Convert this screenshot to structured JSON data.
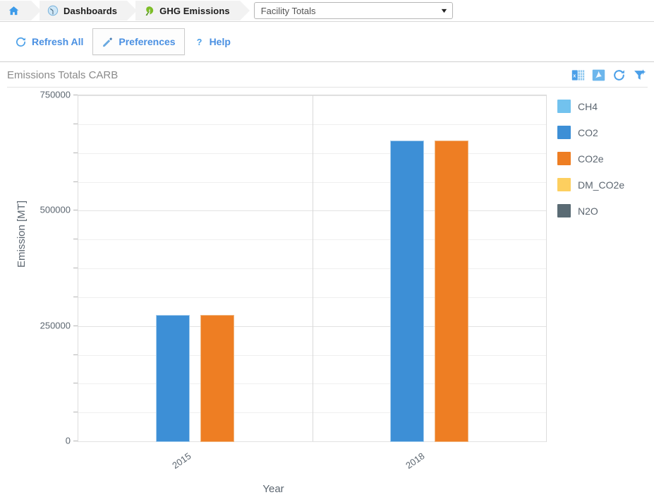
{
  "breadcrumb": {
    "home_icon": "home-icon",
    "items": [
      {
        "icon": "dashboard-gauge-icon",
        "label": "Dashboards"
      },
      {
        "icon": "green-leaf-icon",
        "label": "GHG Emissions"
      }
    ]
  },
  "facility_select": {
    "value": "Facility Totals",
    "caret": "▼",
    "options": [
      "Facility Totals"
    ]
  },
  "toolbar": {
    "refresh_label": "Refresh All",
    "preferences_label": "Preferences",
    "help_label": "Help",
    "help_icon": "question-mark-icon",
    "refresh_icon": "refresh-icon",
    "preferences_icon": "pencil-icon"
  },
  "panel": {
    "title": "Emissions Totals CARB",
    "tools": [
      {
        "name": "export-excel-icon",
        "title": "Excel"
      },
      {
        "name": "export-pdf-icon",
        "title": "PDF"
      },
      {
        "name": "refresh-icon",
        "title": "Refresh"
      },
      {
        "name": "filter-settings-icon",
        "title": "Filter"
      }
    ]
  },
  "colors": {
    "ch4": "#72c2ee",
    "co2": "#3d8fd6",
    "co2e": "#ee7e23",
    "dm_co2e": "#fdcf5f",
    "n2o": "#5a6b74",
    "accent": "#4a90e2",
    "axis_text": "#5c6670"
  },
  "chart_data": {
    "type": "bar",
    "title": "Emissions Totals CARB",
    "xlabel": "Year",
    "ylabel": "Emission [MT]",
    "categories": [
      "2015",
      "2018"
    ],
    "ylim": [
      0,
      750000
    ],
    "ytick_labels": [
      "0",
      "250000",
      "500000",
      "750000"
    ],
    "ytick_values": [
      0,
      250000,
      500000,
      750000
    ],
    "minor_tick_step": 62500,
    "grid": true,
    "legend_position": "right",
    "series": [
      {
        "name": "CH4",
        "color": "#72c2ee",
        "values": [
          0,
          0
        ]
      },
      {
        "name": "CO2",
        "color": "#3d8fd6",
        "values": [
          273000,
          650000
        ]
      },
      {
        "name": "CO2e",
        "color": "#ee7e23",
        "values": [
          273000,
          650000
        ]
      },
      {
        "name": "DM_CO2e",
        "color": "#fdcf5f",
        "values": [
          0,
          0
        ]
      },
      {
        "name": "N2O",
        "color": "#5a6b74",
        "values": [
          0,
          0
        ]
      }
    ],
    "legend": [
      "CH4",
      "CO2",
      "CO2e",
      "DM_CO2e",
      "N2O"
    ]
  }
}
